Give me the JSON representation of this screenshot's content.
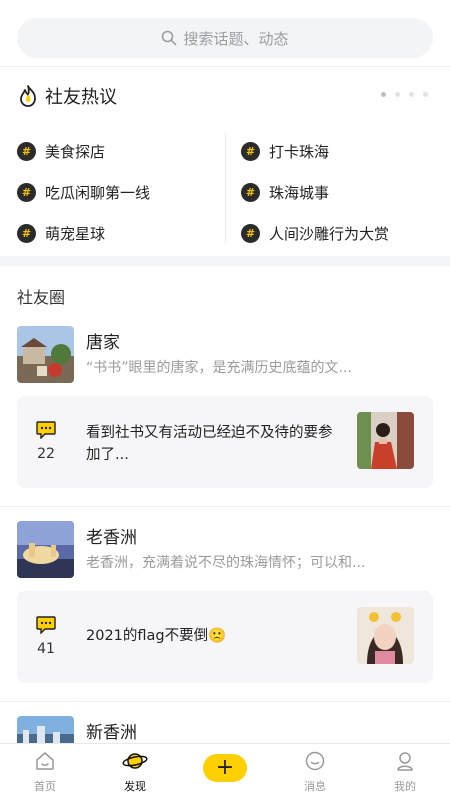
{
  "search": {
    "placeholder": "搜索话题、动态"
  },
  "hot": {
    "title": "社友热议",
    "topics_left": [
      "美食探店",
      "吃瓜闲聊第一线",
      "萌宠星球"
    ],
    "topics_right": [
      "打卡珠海",
      "珠海城事",
      "人间沙雕行为大赏"
    ],
    "hash_symbol": "#"
  },
  "circle": {
    "title": "社友圈",
    "cards": [
      {
        "name": "唐家",
        "desc": "“书书”眼里的唐家，是充满历史底蕴的文...",
        "comment_count": "22",
        "post_text": "看到社书又有活动已经迫不及待的要参加了..."
      },
      {
        "name": "老香洲",
        "desc": "老香洲，充满着说不尽的珠海情怀；可以和...",
        "comment_count": "41",
        "post_text": "2021的flag不要倒🙁"
      },
      {
        "name": "新香洲"
      }
    ]
  },
  "nav": {
    "items": [
      "首页",
      "发现",
      "消息",
      "我的"
    ],
    "add_symbol": "+"
  },
  "colors": {
    "accent": "#ffd000",
    "hash_bg": "#2b2b2b",
    "muted": "#9b9b9b"
  }
}
